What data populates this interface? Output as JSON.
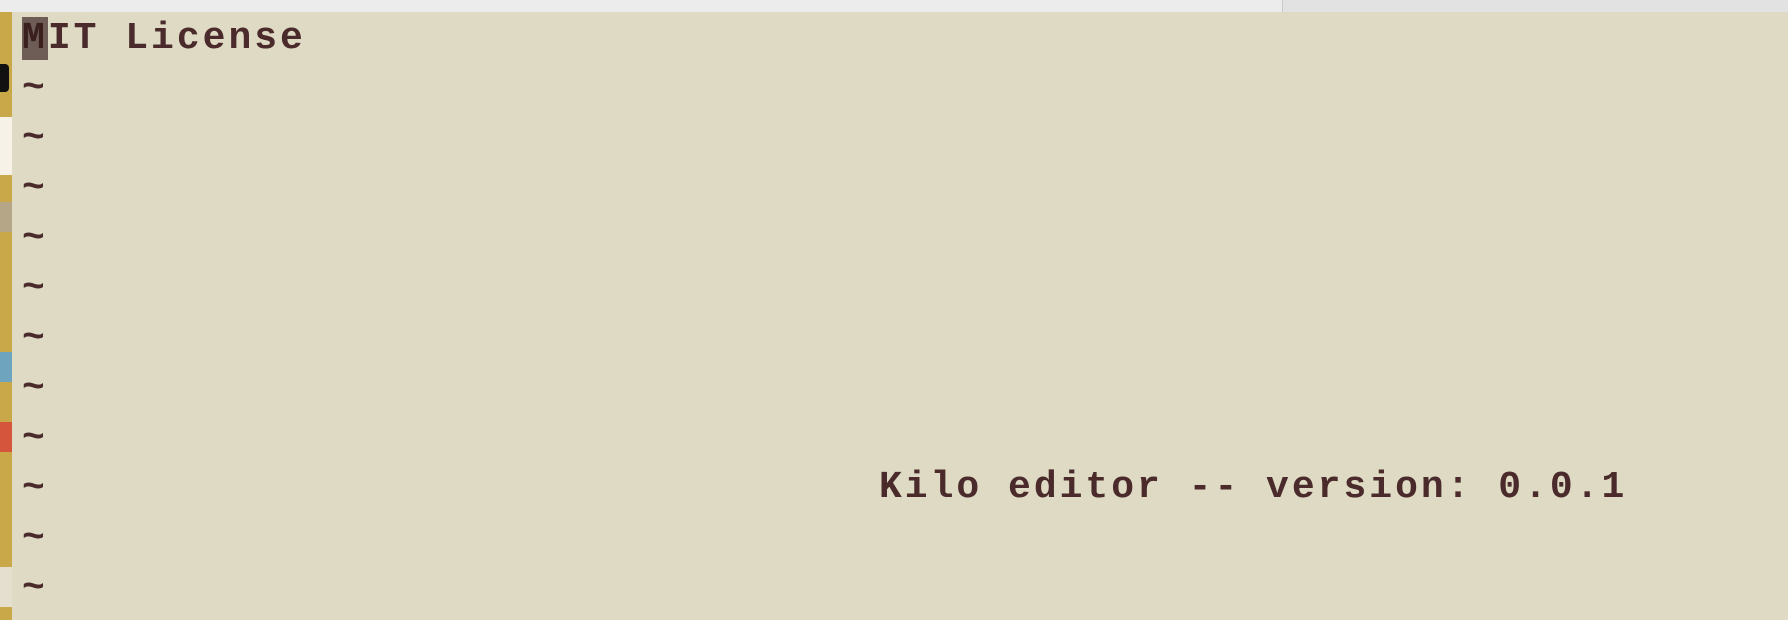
{
  "editor": {
    "first_line_cursor_char": "M",
    "first_line_rest": "IT License",
    "empty_line_marker": "~",
    "welcome_message": "Kilo editor -- version: 0.0.1"
  },
  "colors": {
    "background": "#dedac4",
    "text": "#4a2a2a",
    "cursor": "#6e5c56"
  }
}
